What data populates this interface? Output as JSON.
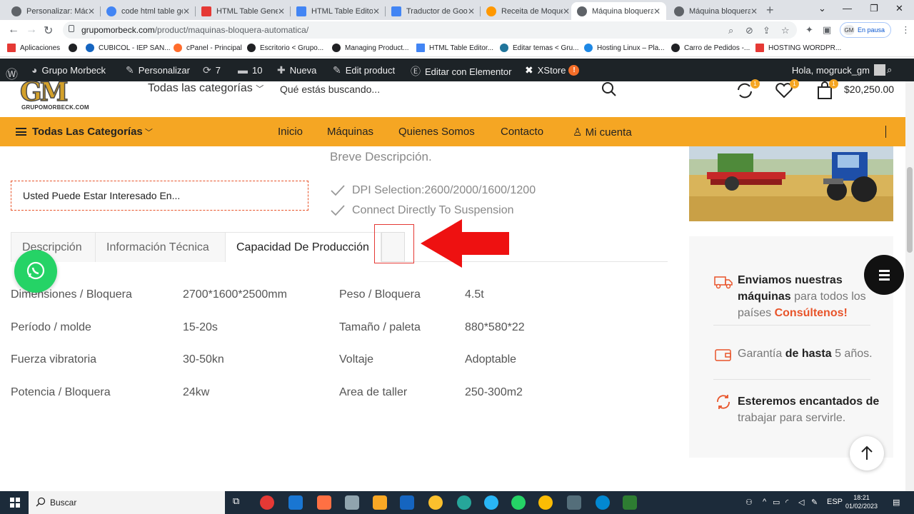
{
  "browser": {
    "tabs": [
      {
        "label": "Personalizar: Máqu",
        "color": "#5f6368"
      },
      {
        "label": "code html table ge",
        "color": "#4285f4"
      },
      {
        "label": "HTML Table Gener",
        "color": "#e53935"
      },
      {
        "label": "HTML Table Editor",
        "color": "#4285f4"
      },
      {
        "label": "Traductor de Goog",
        "color": "#4285f4"
      },
      {
        "label": "Receita de Moquec",
        "color": "#ff9800"
      },
      {
        "label": "Máquina bloquera",
        "color": "#5f6368"
      },
      {
        "label": "Máquina bloquera",
        "color": "#5f6368"
      }
    ],
    "active_tab_index": 6,
    "url_host": "grupomorbeck.com",
    "url_path": "/product/maquinas-bloquera-automatica/",
    "profile_initials": "GM",
    "profile_status": "En pausa",
    "bookmarks": [
      {
        "label": "Aplicaciones",
        "color": "#e53935"
      },
      {
        "label": "",
        "color": "#202124"
      },
      {
        "label": "CUBICOL - IEP SAN...",
        "color": "#1565c0"
      },
      {
        "label": "cPanel - Principal",
        "color": "#ff6c2c"
      },
      {
        "label": "Escritorio < Grupo...",
        "color": "#202124"
      },
      {
        "label": "Managing Product...",
        "color": "#202124"
      },
      {
        "label": "HTML Table Editor...",
        "color": "#4285f4"
      },
      {
        "label": "Editar temas < Gru...",
        "color": "#21759b"
      },
      {
        "label": "Hosting Linux – Pla...",
        "color": "#1e88e5"
      },
      {
        "label": "Carro de Pedidos -...",
        "color": "#202124"
      },
      {
        "label": "HOSTING WORDPR...",
        "color": "#e53935"
      }
    ]
  },
  "wpadmin": {
    "site": "Grupo Morbeck",
    "customize": "Personalizar",
    "updates": "7",
    "comments": "10",
    "new": "Nueva",
    "edit_product": "Edit product",
    "elementor": "Editar con Elementor",
    "xstore": "XStore",
    "xstore_badge": "!",
    "greeting": "Hola, mogruck_gm"
  },
  "header": {
    "logo_letters": "GM",
    "logo_sub": "GRUPOMORBECK.COM",
    "categories": "Todas las categorías",
    "search_placeholder": "Qué estás buscando...",
    "compare_count": "1",
    "wishlist_count": "1",
    "cart_count": "1",
    "cart_total": "$20,250.00"
  },
  "nav": {
    "all_categories": "Todas Las Categorías",
    "links": [
      "Inicio",
      "Máquinas",
      "Quienes Somos",
      "Contacto"
    ],
    "account": "Mi cuenta"
  },
  "product": {
    "brief_title": "Breve Descripción.",
    "features": [
      "DPI Selection:2600/2000/1600/1200",
      "Connect Directly To Suspension"
    ],
    "interest_box": "Usted Puede Estar Interesado En...",
    "tabs": [
      "Descripción",
      "Información Técnica",
      "Capacidad De Producción"
    ],
    "specs": [
      {
        "label": "Dimensiones / Bloquera",
        "value": "2700*1600*2500mm",
        "label2": "Peso / Bloquera",
        "value2": "4.5t"
      },
      {
        "label": "Período / molde",
        "value": "15-20s",
        "label2": "Tamaño / paleta",
        "value2": "880*580*22"
      },
      {
        "label": "Fuerza vibratoria",
        "value": "30-50kn",
        "label2": "Voltaje",
        "value2": "Adoptable"
      },
      {
        "label": "Potencia / Bloquera",
        "value": "24kw",
        "label2": "Area de taller",
        "value2": "250-300m2"
      }
    ]
  },
  "sidebar": {
    "shipping_bold1": "Enviamos nuestras",
    "shipping_bold2": "máquinas",
    "shipping_text": " para todos los países ",
    "shipping_cta": "Consúltenos!",
    "warranty_text": "Garantía ",
    "warranty_bold": "de hasta",
    "warranty_years": " 5 años.",
    "help_bold1": "Esteremos encantados",
    "help_bold2": "de",
    "help_text": " trabajar para servirle."
  },
  "taskbar": {
    "search": "Buscar",
    "lang": "ESP",
    "time": "18:21",
    "date": "01/02/2023"
  },
  "colors": {
    "accent_orange": "#f5a623",
    "wp_bar": "#1d2327",
    "red_annotation": "#e53935",
    "whatsapp": "#25d366"
  }
}
